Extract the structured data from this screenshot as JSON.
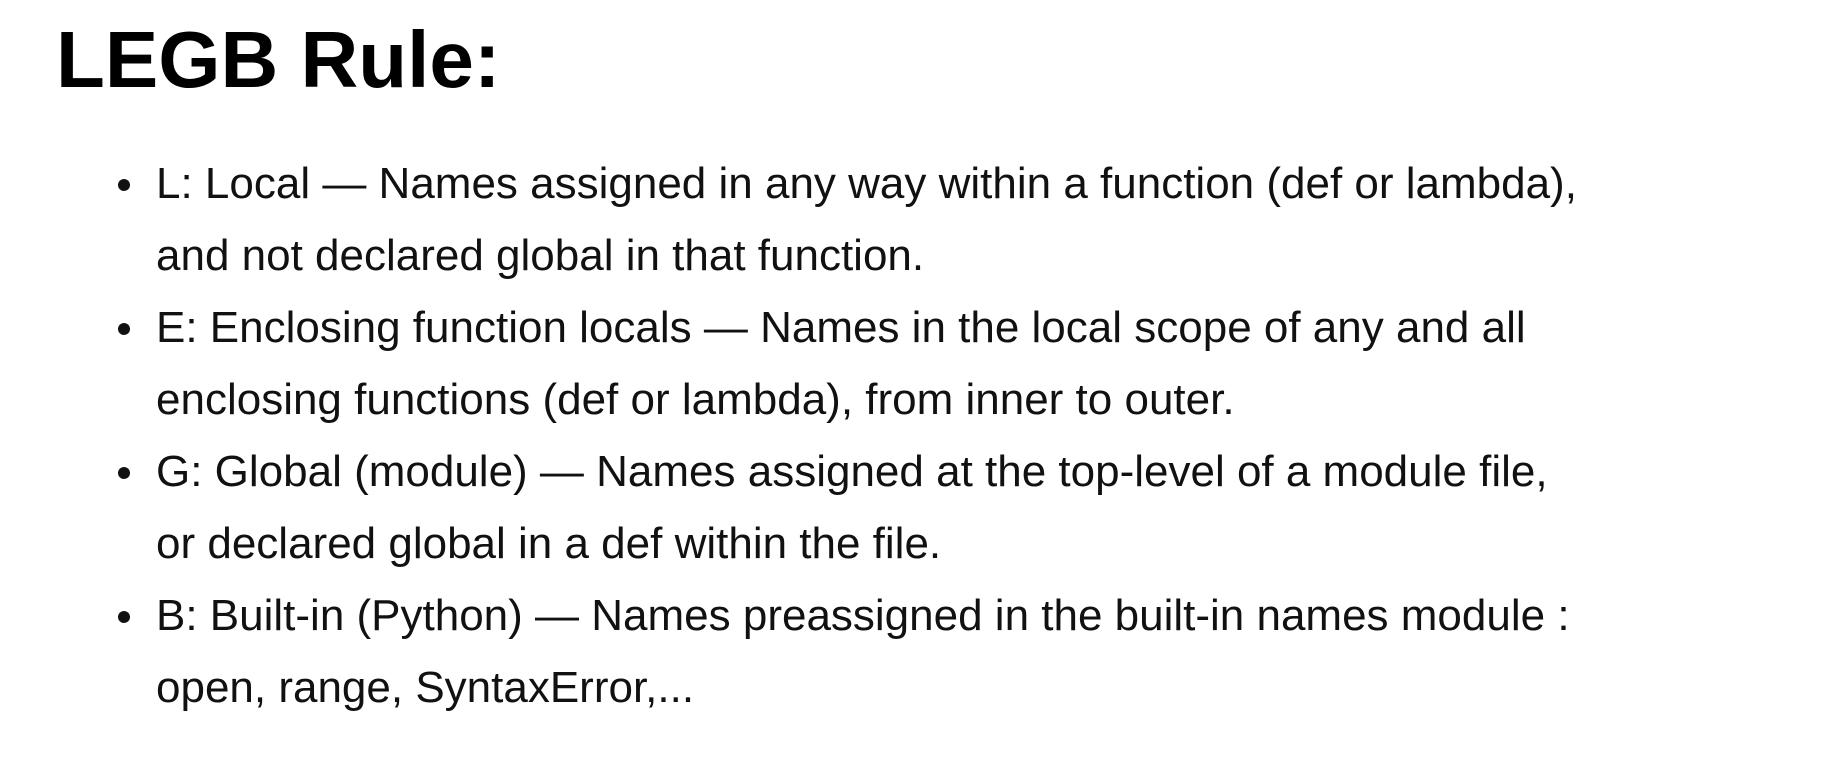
{
  "title": "LEGB Rule:",
  "bullets": [
    {
      "lines": [
        "L: Local — Names assigned in any way within a function (def or lambda),",
        "and not declared global in that function."
      ]
    },
    {
      "lines": [
        "E: Enclosing function locals — Names in the local scope of any and all",
        "enclosing functions (def or lambda), from inner to outer."
      ]
    },
    {
      "lines": [
        "G: Global (module) — Names assigned at the top-level of a module file,",
        "or declared global in a def within the file."
      ]
    },
    {
      "lines": [
        "B: Built-in (Python) — Names preassigned in the built-in names module :",
        "open, range, SyntaxError,..."
      ]
    }
  ]
}
